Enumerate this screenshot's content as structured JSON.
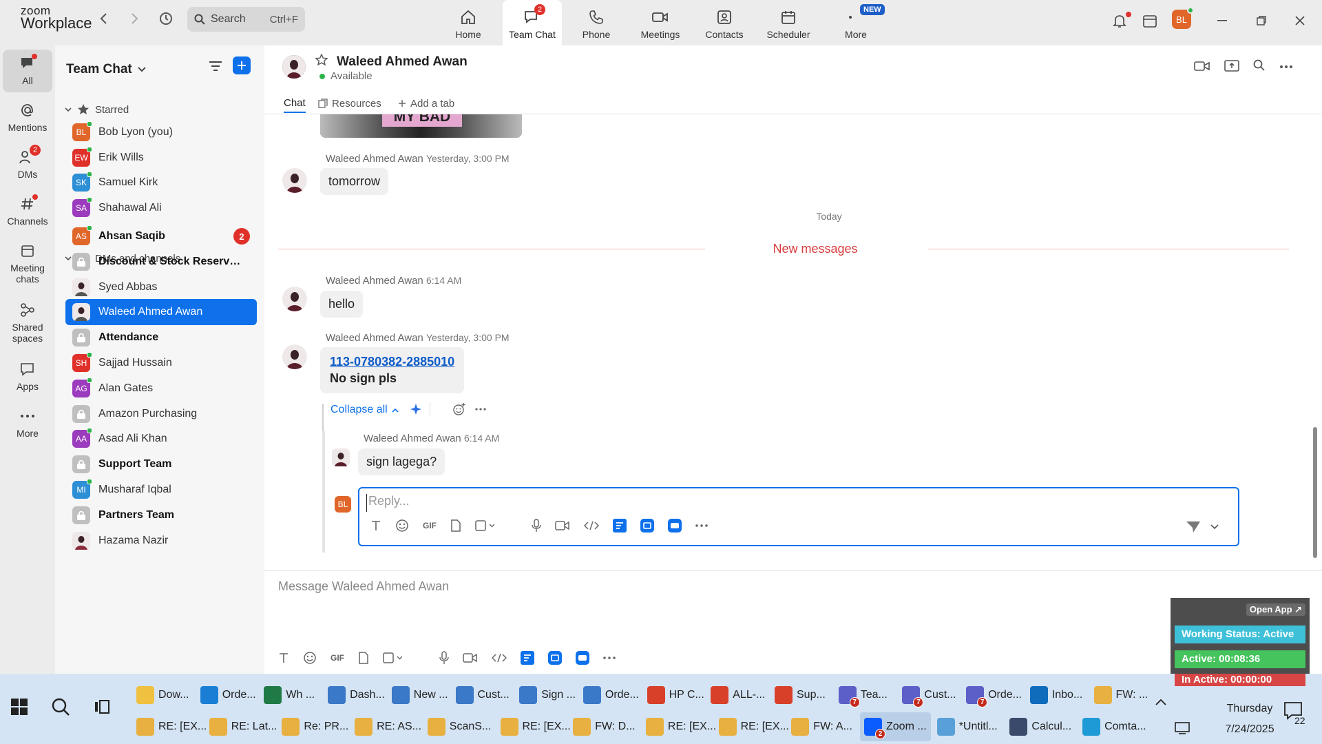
{
  "app": {
    "logo_line1": "zoom",
    "logo_line2": "Workplace"
  },
  "search": {
    "label": "Search",
    "shortcut": "Ctrl+F"
  },
  "top_tabs": [
    {
      "label": "Home",
      "icon": "home-icon"
    },
    {
      "label": "Team Chat",
      "icon": "chat-icon",
      "badge": "2"
    },
    {
      "label": "Phone",
      "icon": "phone-icon"
    },
    {
      "label": "Meetings",
      "icon": "video-icon"
    },
    {
      "label": "Contacts",
      "icon": "contact-icon"
    },
    {
      "label": "Scheduler",
      "icon": "calendar-icon"
    },
    {
      "label": "More",
      "icon": "more-icon",
      "tag": "NEW"
    }
  ],
  "user": {
    "initials": "BL"
  },
  "rail": [
    {
      "label": "All",
      "icon": "chat-bubble-icon"
    },
    {
      "label": "Mentions",
      "icon": "at-icon"
    },
    {
      "label": "DMs",
      "icon": "people-icon",
      "badge": "2"
    },
    {
      "label": "Channels",
      "icon": "hash-icon"
    },
    {
      "label": "Meeting chats",
      "icon": "calendar-icon"
    },
    {
      "label": "Shared spaces",
      "icon": "spaces-icon"
    },
    {
      "label": "Apps",
      "icon": "apps-icon"
    },
    {
      "label": "More",
      "icon": "dots-icon"
    }
  ],
  "sidebar": {
    "title": "Team Chat",
    "section_starred": "Starred",
    "section_dms": "DMs and channels",
    "starred": [
      {
        "initials": "BL",
        "name": "Bob Lyon (you)",
        "color": "#e0662a"
      },
      {
        "initials": "EW",
        "name": "Erik Wills",
        "color": "#e0302a"
      },
      {
        "initials": "SK",
        "name": "Samuel Kirk",
        "color": "#2d8fd5"
      },
      {
        "initials": "SA",
        "name": "Shahawal Ali",
        "color": "#9b3bbd"
      }
    ],
    "items": [
      {
        "initials": "AS",
        "name": "Ahsan Saqib",
        "color": "#e0662a",
        "bold": true,
        "count": "2"
      },
      {
        "initials": "",
        "name": "Discount & Stock Reserva...",
        "color": "#bfbfbf",
        "bold": true,
        "lock": true
      },
      {
        "initials": "",
        "name": "Syed Abbas",
        "color": "#555",
        "photo": true
      },
      {
        "initials": "",
        "name": "Waleed Ahmed Awan",
        "color": "#555",
        "photo": true,
        "selected": true
      },
      {
        "initials": "",
        "name": "Attendance",
        "color": "#bfbfbf",
        "bold": true,
        "lock": true
      },
      {
        "initials": "SH",
        "name": "Sajjad Hussain",
        "color": "#e0302a"
      },
      {
        "initials": "AG",
        "name": "Alan Gates",
        "color": "#9b3bbd"
      },
      {
        "initials": "",
        "name": "Amazon Purchasing",
        "color": "#bfbfbf",
        "lock": true
      },
      {
        "initials": "AA",
        "name": "Asad Ali Khan",
        "color": "#9b3bbd"
      },
      {
        "initials": "",
        "name": "Support Team",
        "color": "#bfbfbf",
        "bold": true,
        "lock": true
      },
      {
        "initials": "MI",
        "name": "Musharaf Iqbal",
        "color": "#2d8fd5"
      },
      {
        "initials": "",
        "name": "Partners Team",
        "color": "#bfbfbf",
        "bold": true,
        "lock": true
      },
      {
        "initials": "",
        "name": "Hazama Nazir",
        "color": "#8a2a3a",
        "photo": true
      }
    ]
  },
  "chat": {
    "contact_name": "Waleed Ahmed Awan",
    "status": "Available",
    "tabs": [
      "Chat",
      "Resources",
      "Add a tab"
    ],
    "image_text": "MY BAD",
    "messages": [
      {
        "sender": "Waleed Ahmed Awan",
        "time": "Yesterday, 3:00 PM",
        "text": "tomorrow"
      },
      {
        "sender": "Waleed Ahmed Awan",
        "time": "6:14 AM",
        "text": "hello"
      },
      {
        "sender": "Waleed Ahmed Awan",
        "time": "Yesterday, 3:00 PM",
        "link": "113-0780382-2885010",
        "text": "No sign pls"
      }
    ],
    "day_divider": "Today",
    "new_divider": "New messages",
    "collapse_label": "Collapse all",
    "reply": {
      "sender": "Waleed Ahmed Awan",
      "time": "6:14 AM",
      "text": "sign lagega?",
      "my_initials": "BL",
      "placeholder": "Reply..."
    },
    "composer_placeholder": "Message Waleed Ahmed Awan"
  },
  "widget": {
    "open_app": "Open App ↗",
    "working_status": "Working Status: Active",
    "active": "Active: 00:08:36",
    "inactive": "In Active: 00:00:00"
  },
  "taskbar": {
    "row1": [
      {
        "label": "Dow...",
        "icon": "folder-icon",
        "color": "#f0c040"
      },
      {
        "label": "Orde...",
        "icon": "edge-icon",
        "color": "#1a7fd4"
      },
      {
        "label": "Wh ...",
        "icon": "excel-icon",
        "color": "#1f7a45"
      },
      {
        "label": "Dash...",
        "icon": "chrome-icon",
        "color": "#3a78c8"
      },
      {
        "label": "New ...",
        "icon": "chrome-icon",
        "color": "#3a78c8"
      },
      {
        "label": "Cust...",
        "icon": "chrome-icon",
        "color": "#3a78c8"
      },
      {
        "label": "Sign ...",
        "icon": "chrome-icon",
        "color": "#3a78c8"
      },
      {
        "label": "Orde...",
        "icon": "chrome-icon",
        "color": "#3a78c8"
      },
      {
        "label": "HP C...",
        "icon": "chrome-icon",
        "color": "#d8402a"
      },
      {
        "label": "ALL-...",
        "icon": "chrome-icon",
        "color": "#d8402a"
      },
      {
        "label": "Sup...",
        "icon": "chrome-icon",
        "color": "#d8402a"
      },
      {
        "label": "Tea...",
        "icon": "teams-icon",
        "color": "#5b5fc7",
        "badge": "7"
      },
      {
        "label": "Cust...",
        "icon": "teams-icon",
        "color": "#5b5fc7",
        "badge": "7"
      },
      {
        "label": "Orde...",
        "icon": "teams-icon",
        "color": "#5b5fc7",
        "badge": "7"
      },
      {
        "label": "Inbo...",
        "icon": "outlook-icon",
        "color": "#0f6cbd"
      },
      {
        "label": "FW: ...",
        "icon": "mail-icon",
        "color": "#e8b040"
      }
    ],
    "row2": [
      {
        "label": "RE: [EX...",
        "icon": "mail-icon",
        "color": "#e8b040"
      },
      {
        "label": "RE: Lat...",
        "icon": "mail-icon",
        "color": "#e8b040"
      },
      {
        "label": "Re: PR...",
        "icon": "mail-icon",
        "color": "#e8b040"
      },
      {
        "label": "RE: AS...",
        "icon": "mail-icon",
        "color": "#e8b040"
      },
      {
        "label": "ScanS...",
        "icon": "mail-icon",
        "color": "#e8b040"
      },
      {
        "label": "RE: [EX...",
        "icon": "mail-icon",
        "color": "#e8b040"
      },
      {
        "label": "FW: D...",
        "icon": "mail-icon",
        "color": "#e8b040"
      },
      {
        "label": "RE: [EX...",
        "icon": "mail-icon",
        "color": "#e8b040"
      },
      {
        "label": "RE: [EX...",
        "icon": "mail-icon",
        "color": "#e8b040"
      },
      {
        "label": "FW: A...",
        "icon": "mail-icon",
        "color": "#e8b040"
      },
      {
        "label": "Zoom ...",
        "icon": "zoom-icon",
        "color": "#0b5cff",
        "badge": "2",
        "active": true
      },
      {
        "label": "*Untitl...",
        "icon": "notepad-icon",
        "color": "#5aa0d8"
      },
      {
        "label": "Calcul...",
        "icon": "calculator-icon",
        "color": "#3a4a6a"
      },
      {
        "label": "Comta...",
        "icon": "app-icon",
        "color": "#1e9bd7"
      }
    ],
    "day": "Thursday",
    "date": "7/24/2025",
    "notif_count": "22"
  }
}
